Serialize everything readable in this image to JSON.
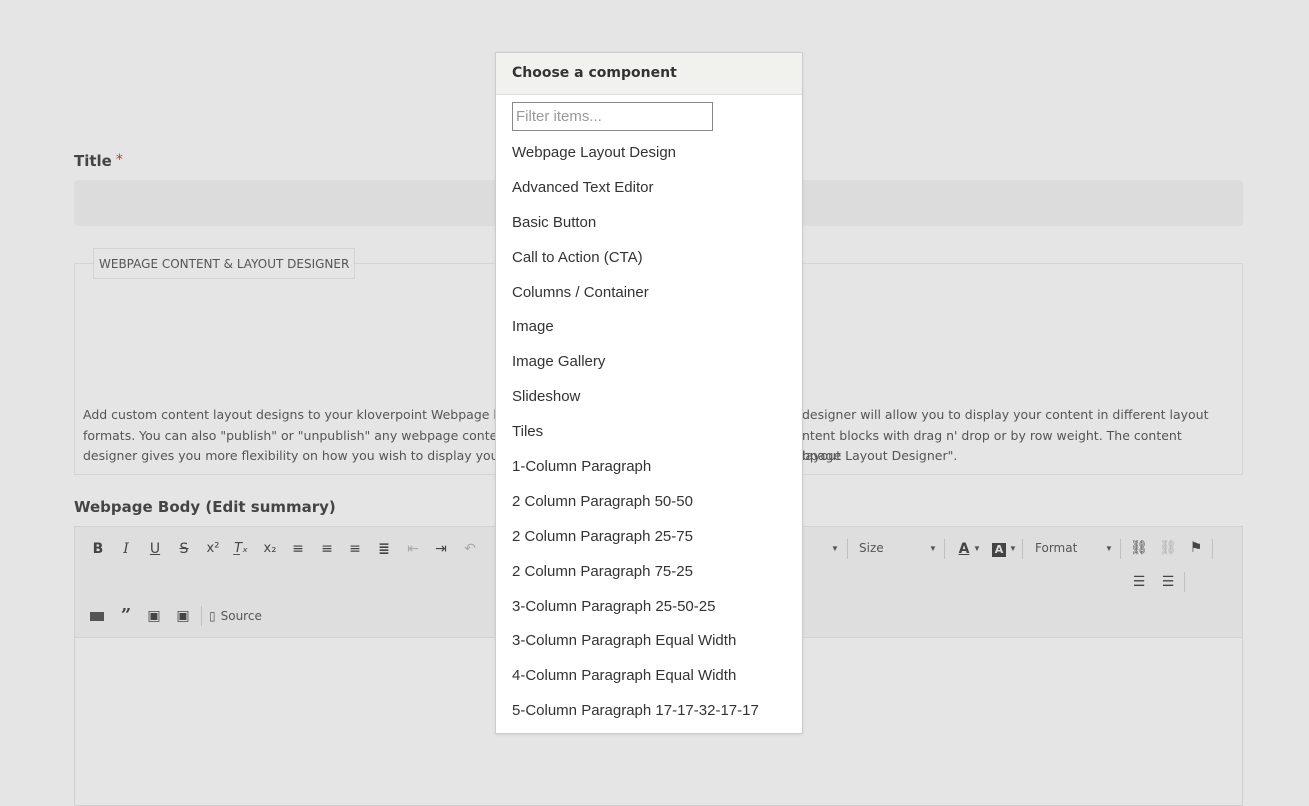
{
  "title_field": {
    "label": "Title",
    "required_marker": "*"
  },
  "layout_designer": {
    "legend": "WEBPAGE CONTENT & LAYOUT DESIGNER",
    "description_visible_line1_left": "Add custom content layout designs to your kloverpoint Webpage by",
    "description_visible_line1_right": "designer will allow you to display your content in different layout",
    "description_visible_line2_left": "formats. You can also \"publish\" or \"unpublish\" any webpage content",
    "description_visible_line2_right": "ntent blocks with drag n' drop or by row weight. The content layout",
    "description_visible_line3_left": "designer gives you more flexibility on how you wish to display your w",
    "description_visible_line3_right": "bpage Layout Designer\"."
  },
  "body_field": {
    "label": "Webpage Body (Edit summary)"
  },
  "editor_toolbar": {
    "size_label": "Size",
    "format_label": "Format",
    "source_label": "Source",
    "icons": [
      "bold-icon",
      "italic-icon",
      "underline-icon",
      "strikethrough-icon",
      "superscript-icon",
      "remove-format-icon",
      "subscript-icon",
      "align-left-icon",
      "align-right-icon",
      "align-center-icon",
      "justify-icon",
      "outdent-icon",
      "indent-icon",
      "undo-icon",
      "text-color-icon",
      "background-color-icon",
      "link-icon",
      "unlink-icon",
      "anchor-flag-icon",
      "bulleted-list-icon",
      "numbered-list-icon",
      "embed-icon",
      "blockquote-icon",
      "image-icon",
      "image-gallery-icon",
      "source-icon"
    ]
  },
  "component_picker": {
    "header": "Choose a component",
    "filter_placeholder": "Filter items...",
    "items": [
      "Webpage Layout Design",
      "Advanced Text Editor",
      "Basic Button",
      "Call to Action (CTA)",
      "Columns / Container",
      "Image",
      "Image Gallery",
      "Slideshow",
      "Tiles",
      "1-Column Paragraph",
      "2 Column Paragraph 50-50",
      "2 Column Paragraph 25-75",
      "2 Column Paragraph 75-25",
      "3-Column Paragraph 25-50-25",
      "3-Column Paragraph Equal Width",
      "4-Column Paragraph Equal Width",
      "5-Column Paragraph 17-17-32-17-17"
    ]
  }
}
